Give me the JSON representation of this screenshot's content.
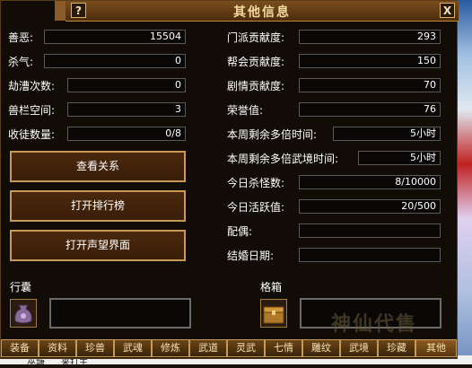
{
  "window": {
    "title": "其他信息",
    "help_label": "?",
    "close_label": "X"
  },
  "left_stats": [
    {
      "label": "善恶:",
      "value": "15504"
    },
    {
      "label": "杀气:",
      "value": "0"
    },
    {
      "label": "劫漕次数:",
      "value": "0"
    },
    {
      "label": "兽栏空间:",
      "value": "3"
    },
    {
      "label": "收徒数量:",
      "value": "0/8"
    }
  ],
  "right_stats": [
    {
      "label": "门派贡献度:",
      "value": "293"
    },
    {
      "label": "帮会贡献度:",
      "value": "150"
    },
    {
      "label": "剧情贡献度:",
      "value": "70"
    },
    {
      "label": "荣誉值:",
      "value": "76"
    },
    {
      "label": "本周剩余多倍时间:",
      "value": "5小时"
    },
    {
      "label": "本周剩余多倍武境时间:",
      "value": "5小时"
    },
    {
      "label": "今日杀怪数:",
      "value": "8/10000"
    },
    {
      "label": "今日活跃值:",
      "value": "20/500"
    },
    {
      "label": "配偶:",
      "value": ""
    },
    {
      "label": "结婚日期:",
      "value": ""
    }
  ],
  "buttons": {
    "view_relations": "查看关系",
    "open_ranking": "打开排行榜",
    "open_reputation": "打开声望界面"
  },
  "bag": {
    "label": "行囊"
  },
  "chest": {
    "label": "格箱"
  },
  "tabs": [
    "装备",
    "资料",
    "珍兽",
    "武魂",
    "修炼",
    "武道",
    "灵武",
    "七情",
    "雕纹",
    "武境",
    "珍藏",
    "其他"
  ],
  "watermark": "神仙代售",
  "footer_text": [
    "巫塘",
    "来打主"
  ],
  "colors": {
    "frame_gold": "#c89a5a",
    "title_text": "#f4d9a0",
    "panel_bg": "#120c06"
  }
}
